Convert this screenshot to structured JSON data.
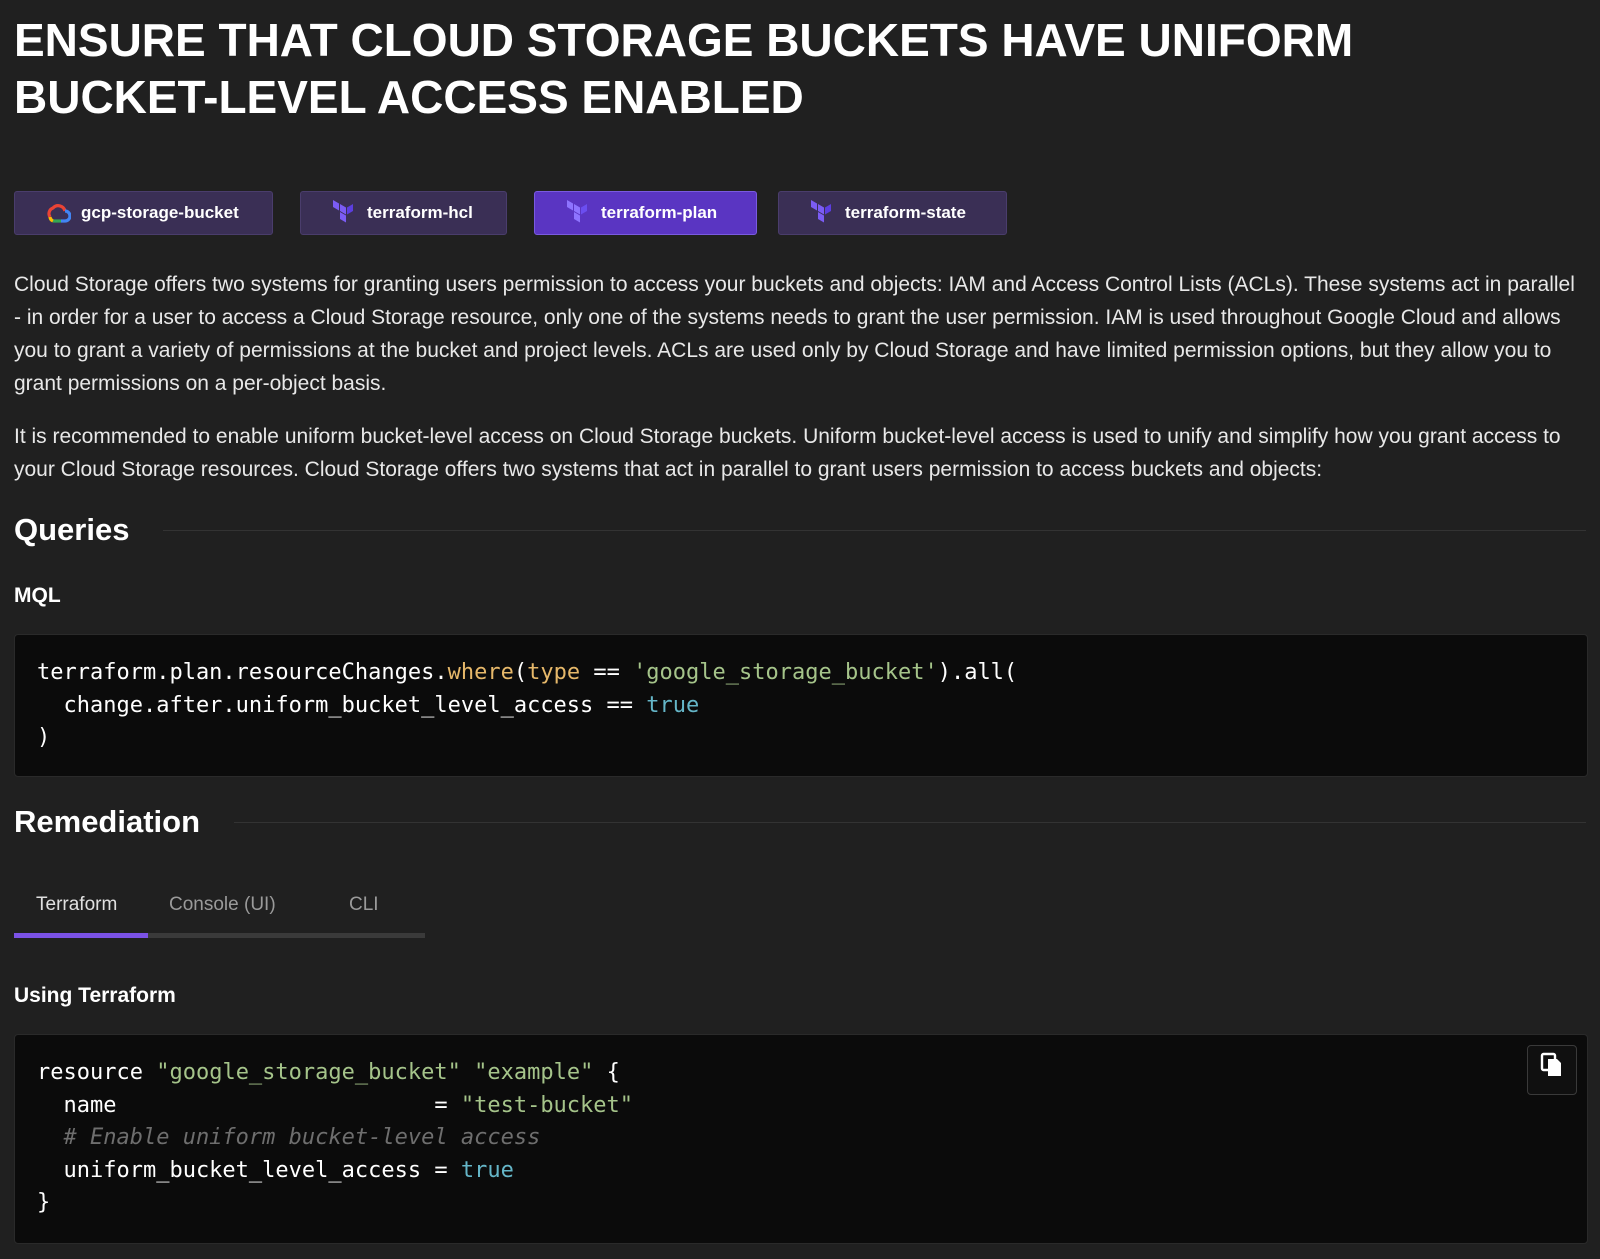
{
  "page": {
    "title": "ENSURE THAT CLOUD STORAGE BUCKETS HAVE UNIFORM BUCKET-LEVEL ACCESS ENABLED"
  },
  "tags": [
    {
      "label": "gcp-storage-bucket",
      "icon": "google-cloud-icon",
      "active": false
    },
    {
      "label": "terraform-hcl",
      "icon": "terraform-icon",
      "active": false
    },
    {
      "label": "terraform-plan",
      "icon": "terraform-icon",
      "active": true
    },
    {
      "label": "terraform-state",
      "icon": "terraform-icon",
      "active": false
    }
  ],
  "description": {
    "p1": "Cloud Storage offers two systems for granting users permission to access your buckets and objects: IAM and Access Control Lists (ACLs). These systems act in parallel - in order for a user to access a Cloud Storage resource, only one of the systems needs to grant the user permission. IAM is used throughout Google Cloud and allows you to grant a variety of permissions at the bucket and project levels. ACLs are used only by Cloud Storage and have limited permission options, but they allow you to grant permissions on a per-object basis.",
    "p2": "It is recommended to enable uniform bucket-level access on Cloud Storage buckets. Uniform bucket-level access is used to unify and simplify how you grant access to your Cloud Storage resources. Cloud Storage offers two systems that act in parallel to grant users permission to access buckets and objects:"
  },
  "queries": {
    "heading": "Queries",
    "subheading": "MQL",
    "code": {
      "l1_a": "terraform.plan.resourceChanges.",
      "l1_fn": "where",
      "l1_b": "(",
      "l1_type": "type",
      "l1_c": " == ",
      "l1_str": "'google_storage_bucket'",
      "l1_d": ").all(",
      "l2_a": "  change.after.uniform_bucket_level_access == ",
      "l2_bool": "true",
      "l3": ")"
    }
  },
  "remediation": {
    "heading": "Remediation",
    "tabs": [
      {
        "label": "Terraform",
        "active": true
      },
      {
        "label": "Console (UI)",
        "active": false
      },
      {
        "label": "CLI",
        "active": false
      }
    ],
    "subheading": "Using Terraform",
    "code": {
      "l1_a": "resource ",
      "l1_s1": "\"google_storage_bucket\"",
      "l1_sp": " ",
      "l1_s2": "\"example\"",
      "l1_b": " {",
      "l2_a": "  name                        = ",
      "l2_s": "\"test-bucket\"",
      "l3_com": "  # Enable uniform bucket-level access",
      "l4_a": "  uniform_bucket_level_access = ",
      "l4_bool": "true",
      "l5": "}"
    },
    "copy_icon": "copy-icon"
  },
  "colors": {
    "background": "#202020",
    "tag_bg": "#3a2f55",
    "tag_active_bg": "#5a35c2",
    "tab_indicator": "#7b52e6",
    "code_bg": "#0b0b0b"
  }
}
